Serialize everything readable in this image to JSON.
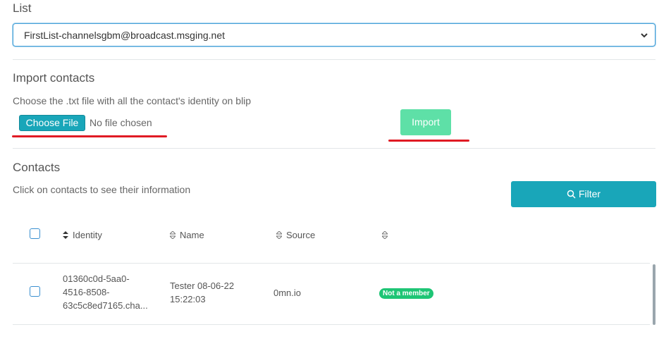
{
  "list": {
    "label": "List",
    "selected": "FirstList-channelsgbm@broadcast.msging.net"
  },
  "import": {
    "title": "Import contacts",
    "hint": "Choose the .txt file with all the contact's identity on blip",
    "choose_file_label": "Choose File",
    "no_file_text": "No file chosen",
    "import_label": "Import"
  },
  "contacts": {
    "title": "Contacts",
    "hint": "Click on contacts to see their information",
    "filter_label": "Filter",
    "columns": [
      "Identity",
      "Name",
      "Source",
      ""
    ],
    "rows": [
      {
        "identity_lines": [
          "01360c0d-5aa0-",
          "4516-8508-",
          "63c5c8ed7165.cha..."
        ],
        "name_lines": [
          "Tester 08-06-22",
          "15:22:03"
        ],
        "source": "0mn.io",
        "status": "Not a member"
      }
    ]
  },
  "colors": {
    "accent": "#19a6b9",
    "import_button": "#5ee0a7",
    "badge": "#1ec575",
    "annotation_underline": "#e01b24"
  }
}
